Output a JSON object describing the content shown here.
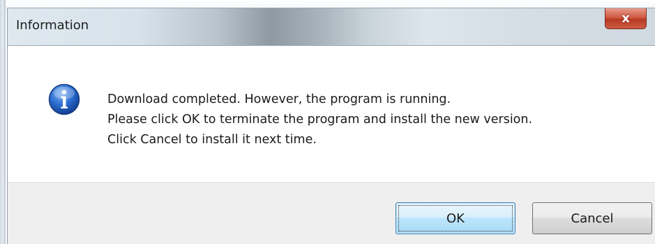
{
  "window": {
    "title": "Information"
  },
  "title_bar": {
    "close_icon": "x-icon",
    "close_label": "x"
  },
  "dialog": {
    "icon": "information-icon",
    "message_lines": [
      "Download completed. However, the program is running.",
      "Please click OK to terminate the program and install the new version.",
      "Click Cancel to install it next time."
    ]
  },
  "buttons": {
    "ok_label": "OK",
    "cancel_label": "Cancel"
  },
  "colors": {
    "close_button": "#c9483a",
    "ok_button_border": "#3c7fb1",
    "footer_background": "#efefef",
    "info_icon_blue": "#1f5fbf"
  }
}
